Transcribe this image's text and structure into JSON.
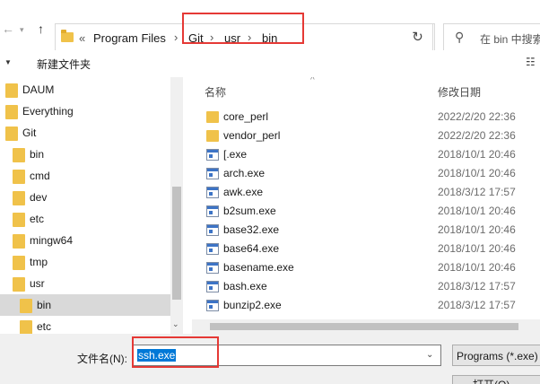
{
  "window": {
    "title_partial": ""
  },
  "nav": {
    "back_icon": "arrow-left-icon",
    "forward_icon": "arrow-right-icon",
    "dropdown_icon": "chevron-down-icon",
    "up_icon": "arrow-up-icon",
    "overflow": "«",
    "breadcrumbs": [
      "Program Files",
      "Git",
      "usr",
      "bin"
    ],
    "refresh_icon": "refresh-icon",
    "search_placeholder": "在 bin 中搜索"
  },
  "toolbar": {
    "new_folder_label": "新建文件夹"
  },
  "tree": {
    "items": [
      {
        "label": "DAUM"
      },
      {
        "label": "Everything"
      },
      {
        "label": "Git"
      },
      {
        "label": "bin"
      },
      {
        "label": "cmd"
      },
      {
        "label": "dev"
      },
      {
        "label": "etc"
      },
      {
        "label": "mingw64"
      },
      {
        "label": "tmp"
      },
      {
        "label": "usr"
      },
      {
        "label": "bin",
        "selected": true
      },
      {
        "label": "etc"
      }
    ]
  },
  "list": {
    "columns": {
      "name": "名称",
      "modified": "修改日期"
    },
    "rows": [
      {
        "type": "folder",
        "name": "core_perl",
        "date": "2022/2/20 22:36"
      },
      {
        "type": "folder",
        "name": "vendor_perl",
        "date": "2022/2/20 22:36"
      },
      {
        "type": "exe",
        "name": "[.exe",
        "date": "2018/10/1 20:46"
      },
      {
        "type": "exe",
        "name": "arch.exe",
        "date": "2018/10/1 20:46"
      },
      {
        "type": "exe",
        "name": "awk.exe",
        "date": "2018/3/12 17:57"
      },
      {
        "type": "exe",
        "name": "b2sum.exe",
        "date": "2018/10/1 20:46"
      },
      {
        "type": "exe",
        "name": "base32.exe",
        "date": "2018/10/1 20:46"
      },
      {
        "type": "exe",
        "name": "base64.exe",
        "date": "2018/10/1 20:46"
      },
      {
        "type": "exe",
        "name": "basename.exe",
        "date": "2018/10/1 20:46"
      },
      {
        "type": "exe",
        "name": "bash.exe",
        "date": "2018/3/12 17:57"
      },
      {
        "type": "exe",
        "name": "bunzip2.exe",
        "date": "2018/3/12 17:57"
      }
    ]
  },
  "bottom": {
    "filename_label": "文件名(N):",
    "filename_value": "ssh.exe",
    "filetype_value": "Programs (*.exe)",
    "open_label": "打开(O)"
  },
  "colors": {
    "highlight": "#e53935",
    "selection": "#0078d7",
    "folder": "#f0c24a"
  }
}
